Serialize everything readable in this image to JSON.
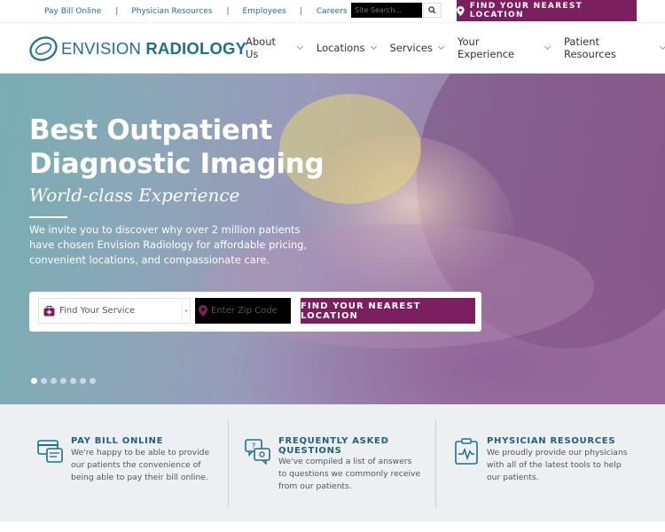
{
  "utility": {
    "links": [
      "Pay Bill Online",
      "Physician Resources",
      "Employees",
      "Careers",
      "C"
    ],
    "search_placeholder": "Site Search...",
    "cta": "FIND YOUR NEAREST LOCATION"
  },
  "brand": {
    "name_light": "ENVISION",
    "name_bold": "RADIOLOGY",
    "color_primary": "#1f6f8b",
    "color_accent": "#7b1f5e"
  },
  "nav": {
    "items": [
      "About Us",
      "Locations",
      "Services",
      "Your Experience",
      "Patient Resources"
    ]
  },
  "hero": {
    "title_line1": "Best Outpatient",
    "title_line2": "Diagnostic Imaging",
    "tagline": "World-class Experience",
    "intro": "We invite you to discover why over 2 million patients have chosen Envision Radiology for affordable pricing, convenient locations, and compassionate care.",
    "service_placeholder": "Find Your Service",
    "zip_placeholder": "Enter Zip Code",
    "find_button": "FIND YOUR NEAREST LOCATION",
    "slides": 7,
    "active_slide": 1
  },
  "features": [
    {
      "icon": "credit-card-icon",
      "title": "PAY BILL ONLINE",
      "text_lines": [
        "We're happy to be able to provide",
        "our patients the convenience of",
        "being able to pay their bill online."
      ]
    },
    {
      "icon": "faq-chat-icon",
      "title_lines": [
        "FREQUENTLY ASKED",
        "QUESTIONS"
      ],
      "text_lines": [
        "We've compiled a list of answers",
        "to questions we commonly receive",
        "from our patients."
      ]
    },
    {
      "icon": "clipboard-pulse-icon",
      "title": "PHYSICIAN RESOURCES",
      "text_lines": [
        "We proudly provide our physicians",
        "with all of the latest tools to help",
        "our patients."
      ]
    }
  ]
}
